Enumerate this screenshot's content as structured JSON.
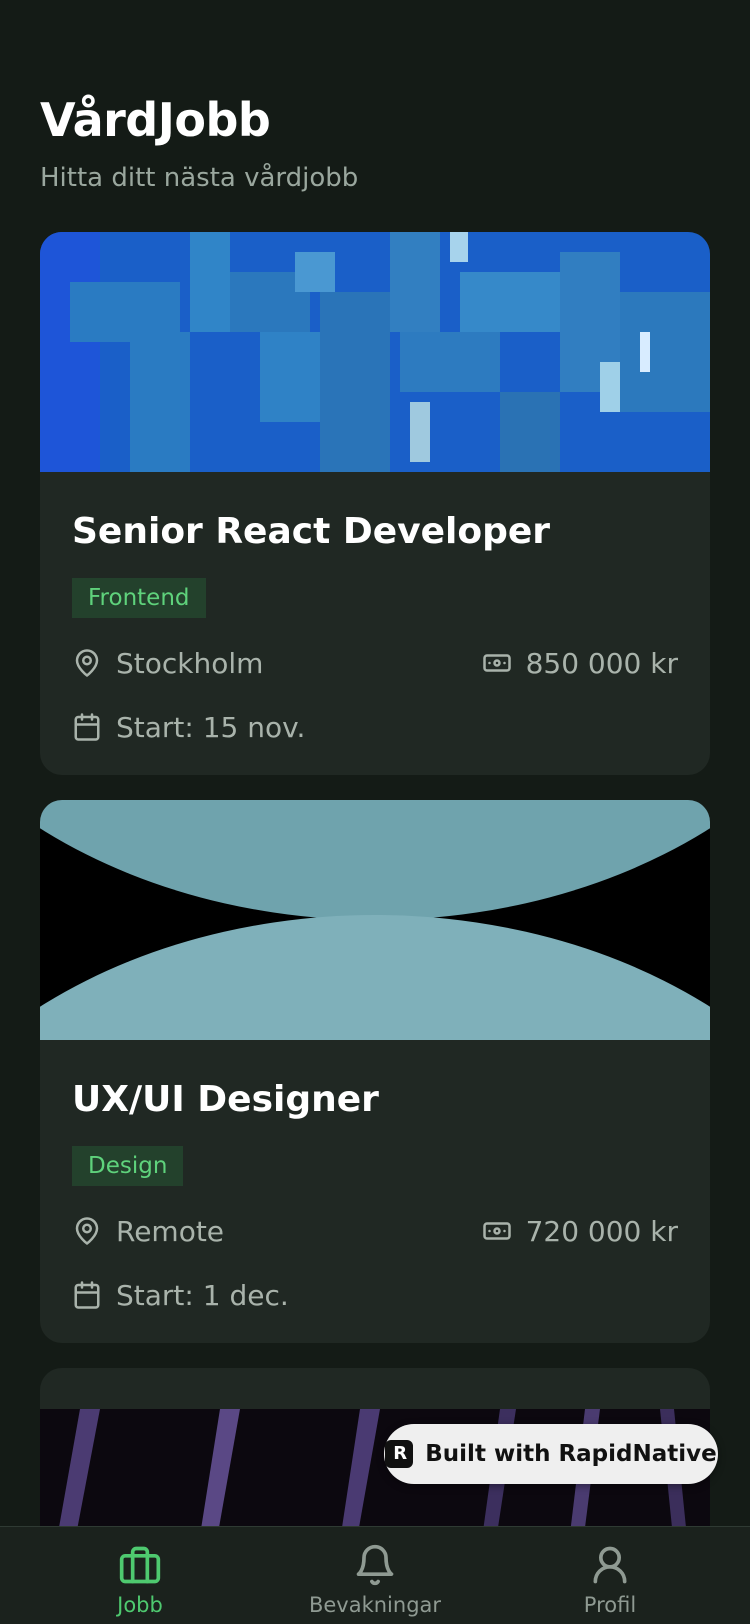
{
  "header": {
    "title": "VårdJobb",
    "subtitle": "Hitta ditt nästa vårdjobb"
  },
  "jobs": [
    {
      "title": "Senior React Developer",
      "tag": "Frontend",
      "location": "Stockholm",
      "salary": "850 000 kr",
      "start": "Start: 15 nov.",
      "image": "blue-maze-3d"
    },
    {
      "title": "UX/UI Designer",
      "tag": "Design",
      "location": "Remote",
      "salary": "720 000 kr",
      "start": "Start: 1 dec.",
      "image": "dark-planet-horizon"
    },
    {
      "image": "purple-dark-stripes"
    }
  ],
  "badge": {
    "label": "Built with RapidNative"
  },
  "tabbar": {
    "items": [
      {
        "label": "Jobb",
        "icon": "briefcase-icon",
        "active": true
      },
      {
        "label": "Bevakningar",
        "icon": "bell-icon",
        "active": false
      },
      {
        "label": "Profil",
        "icon": "user-icon",
        "active": false
      }
    ]
  },
  "colors": {
    "background": "#141b16",
    "card": "#202823",
    "accent": "#4ec96f",
    "tag_bg": "#23412c"
  }
}
